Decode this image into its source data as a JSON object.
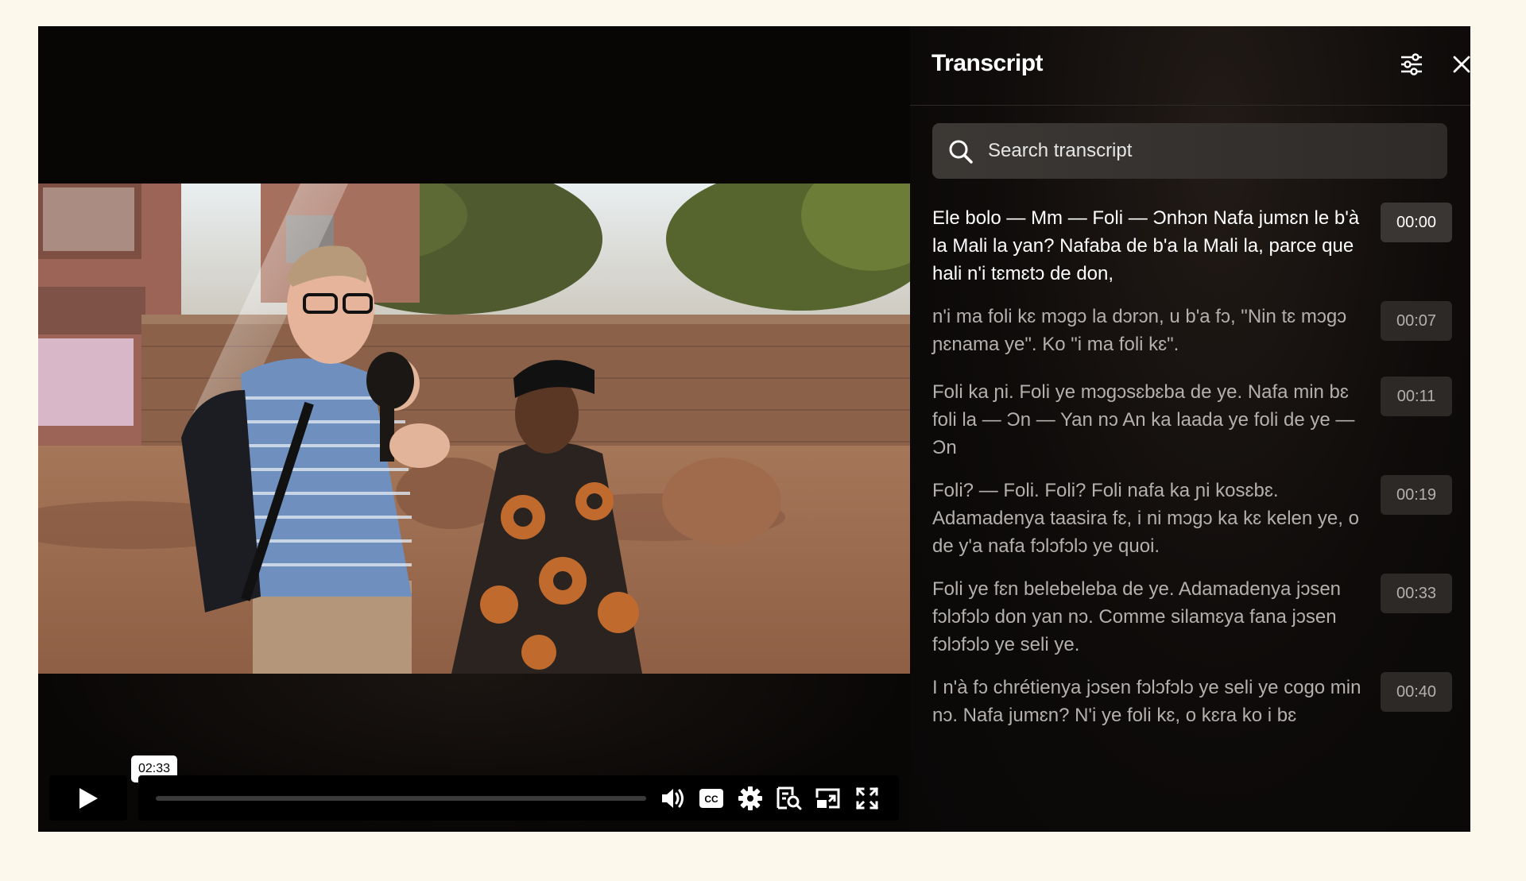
{
  "video": {
    "tooltip_time": "02:33",
    "progress_fraction": 0.0
  },
  "controls": {
    "play_icon": "play-icon",
    "volume_icon": "volume-icon",
    "captions_icon": "closed-captions-icon",
    "captions_label": "CC",
    "settings_icon": "gear-icon",
    "transcript_icon": "transcript-search-icon",
    "pip_icon": "picture-in-picture-icon",
    "fullscreen_icon": "fullscreen-icon"
  },
  "transcript": {
    "title": "Transcript",
    "settings_icon": "sliders-icon",
    "close_icon": "close-icon",
    "search_placeholder": "Search transcript",
    "entries": [
      {
        "text": "Ele bolo — Mm — Foli — Ɔnhɔn Nafa jumɛn le b'à la Mali la yan? Nafaba de b'a la Mali la, parce que hali n'i tɛmɛtɔ de don,",
        "time": "00:00",
        "active": true
      },
      {
        "text": "n'i ma foli kɛ mɔgɔ la dɔrɔn, u b'a fɔ, \"Nin tɛ mɔgɔ ɲɛnama ye\". Ko \"i ma foli kɛ\".",
        "time": "00:07",
        "active": false
      },
      {
        "text": "Foli ka ɲi. Foli ye mɔgɔsɛbɛba de ye. Nafa min bɛ foli la — Ɔn — Yan nɔ An ka laada ye foli de ye — Ɔn",
        "time": "00:11",
        "active": false
      },
      {
        "text": "Foli? — Foli. Foli? Foli nafa ka ɲi kosɛbɛ. Adamadenya taasira fɛ, i ni mɔgɔ ka kɛ kelen ye, o de y'a nafa fɔlɔfɔlɔ ye quoi.",
        "time": "00:19",
        "active": false
      },
      {
        "text": "Foli ye fɛn belebeleba de ye. Adamadenya jɔsen fɔlɔfɔlɔ don yan nɔ. Comme silamɛya fana jɔsen fɔlɔfɔlɔ ye seli ye.",
        "time": "00:33",
        "active": false
      },
      {
        "text": "I n'à fɔ chrétienya jɔsen fɔlɔfɔlɔ ye seli ye cogo min nɔ. Nafa jumɛn? N'i ye foli kɛ, o kɛra ko i bɛ",
        "time": "00:40",
        "active": false
      }
    ]
  },
  "colors": {
    "page_background": "#fcf9ec",
    "player_background": "#0b0908",
    "active_text": "#ffffff",
    "inactive_text": "#b3b0ad"
  }
}
